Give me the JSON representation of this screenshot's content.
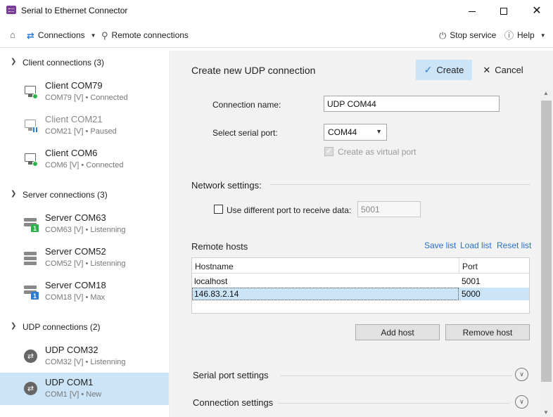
{
  "window": {
    "title": "Serial to Ethernet Connector"
  },
  "toolbar": {
    "connections_label": "Connections",
    "remote_label": "Remote connections",
    "stop_label": "Stop service",
    "help_label": "Help"
  },
  "sidebar": {
    "groups": [
      {
        "title": "Client connections (3)",
        "items": [
          {
            "name": "Client COM79",
            "sub": "COM79 [V] • Connected"
          },
          {
            "name": "Client COM21",
            "sub": "COM21 [V] • Paused"
          },
          {
            "name": "Client COM6",
            "sub": "COM6 [V] • Connected"
          }
        ]
      },
      {
        "title": "Server connections (3)",
        "items": [
          {
            "name": "Server COM63",
            "sub": "COM63 [V] • Listenning",
            "badge": "1"
          },
          {
            "name": "Server COM52",
            "sub": "COM52 [V] • Listenning"
          },
          {
            "name": "Server COM18",
            "sub": "COM18 [V] • Max",
            "badge": "1"
          }
        ]
      },
      {
        "title": "UDP connections (2)",
        "items": [
          {
            "name": "UDP COM32",
            "sub": "COM32 [V] • Listenning"
          },
          {
            "name": "UDP COM1",
            "sub": "COM1 [V] • New"
          }
        ]
      }
    ]
  },
  "form": {
    "title": "Create new UDP connection",
    "create_label": "Create",
    "cancel_label": "Cancel",
    "conn_name_label": "Connection name:",
    "conn_name_value": "UDP COM44",
    "serial_port_label": "Select serial port:",
    "serial_port_value": "COM44",
    "virtual_port_label": "Create as virtual port",
    "network_title": "Network settings:",
    "diff_port_label": "Use different port to receive data:",
    "diff_port_value": "5001",
    "remote_title": "Remote hosts",
    "save_list": "Save list",
    "load_list": "Load list",
    "reset_list": "Reset list",
    "table": {
      "col_host": "Hostname",
      "col_port": "Port",
      "rows": [
        {
          "host": "localhost",
          "port": "5001"
        },
        {
          "host": "146.83.2.14",
          "port": "5000"
        }
      ]
    },
    "add_host": "Add host",
    "remove_host": "Remove host",
    "serial_settings_title": "Serial port settings",
    "connection_settings_title": "Connection settings"
  },
  "colors": {
    "accent": "#cce4f7",
    "link": "#2a6fc9",
    "connected": "#2db24a",
    "server_badge_green": "#2db24a",
    "server_badge_blue": "#2b7bd6"
  }
}
